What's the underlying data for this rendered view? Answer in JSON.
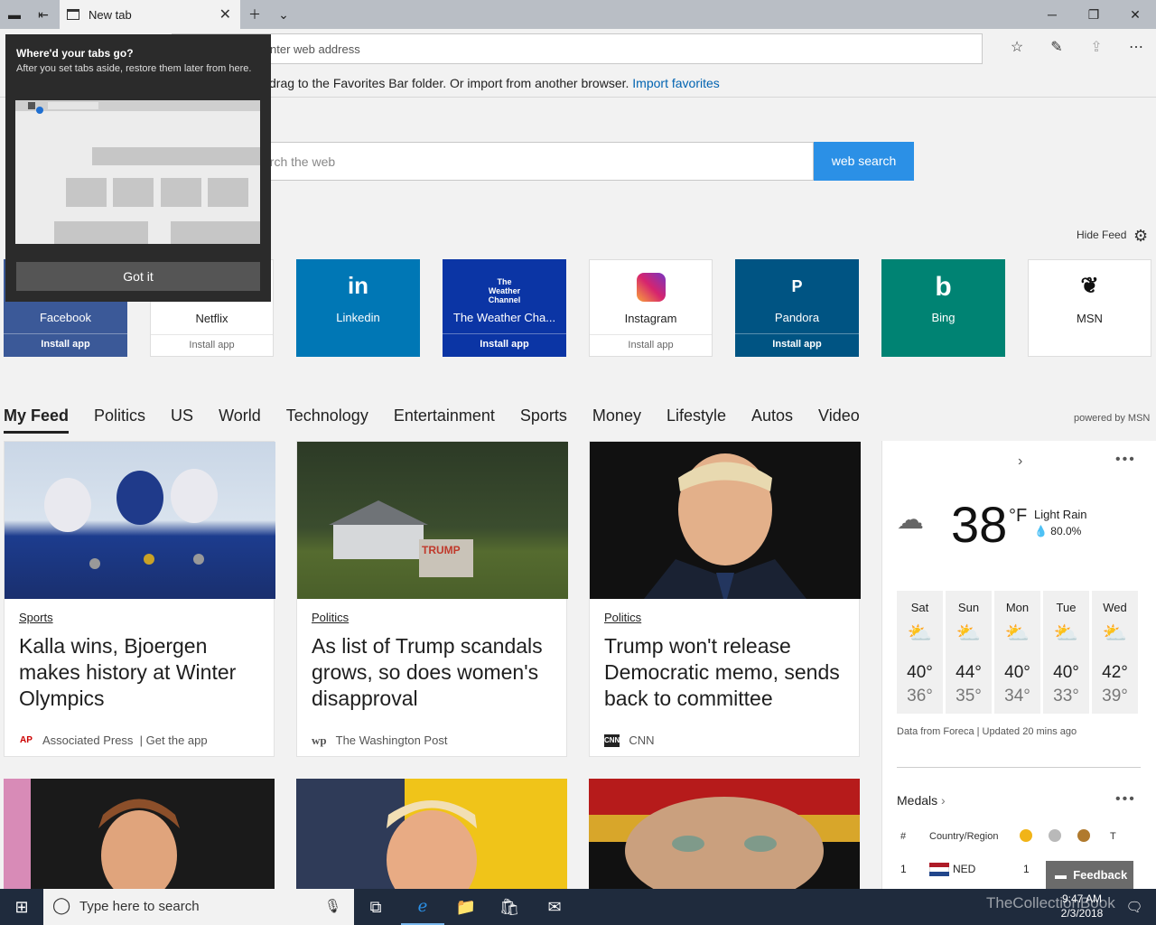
{
  "browser": {
    "tab_title": "New tab",
    "address_placeholder": "Search or enter web address",
    "address_visible": "nter web address",
    "favbar_text": "drag to the Favorites Bar folder. Or import from another browser.",
    "favbar_link": "Import favorites"
  },
  "popup": {
    "title": "Where'd your tabs go?",
    "desc": "After you set tabs aside, restore them later from here.",
    "button": "Got it"
  },
  "search": {
    "placeholder_visible": "arch the web",
    "button": "web search"
  },
  "hide_feed": "Hide Feed",
  "tiles": [
    {
      "name": "Facebook",
      "install": "Install app",
      "bg": "#3b5998",
      "glyph": "f"
    },
    {
      "name": "Netflix",
      "install": "Install app",
      "bg": "#ffffff",
      "glyph": "N"
    },
    {
      "name": "Linkedin",
      "install": "",
      "bg": "#0077b5",
      "glyph": "in"
    },
    {
      "name": "The Weather Cha...",
      "install": "Install app",
      "bg": "#0b35a5",
      "glyph": "TWC"
    },
    {
      "name": "Instagram",
      "install": "Install app",
      "bg": "#ffffff",
      "glyph": "IG"
    },
    {
      "name": "Pandora",
      "install": "Install app",
      "bg": "#005483",
      "glyph": "P"
    },
    {
      "name": "Bing",
      "install": "",
      "bg": "#008373",
      "glyph": "b"
    },
    {
      "name": "MSN",
      "install": "",
      "bg": "#ffffff",
      "glyph": "MSN"
    }
  ],
  "feed_tabs": [
    "My Feed",
    "Politics",
    "US",
    "World",
    "Technology",
    "Entertainment",
    "Sports",
    "Money",
    "Lifestyle",
    "Autos",
    "Video"
  ],
  "powered_by": "powered by MSN",
  "articles": [
    {
      "category": "Sports",
      "headline": "Kalla wins, Bjoergen makes history at Winter Olympics",
      "source": "Associated Press",
      "extra": "| Get the app",
      "logo": "AP"
    },
    {
      "category": "Politics",
      "headline": "As list of Trump scandals grows, so does women's disapproval",
      "source": "The Washington Post",
      "extra": "",
      "logo": "wp"
    },
    {
      "category": "Politics",
      "headline": "Trump won't release Democratic memo, sends back to committee",
      "source": "CNN",
      "extra": "",
      "logo": "CNN"
    }
  ],
  "weather": {
    "temp": "38",
    "unit": "°F",
    "condition": "Light Rain",
    "precip": "80.0%",
    "days": [
      {
        "day": "Sat",
        "hi": "40°",
        "lo": "36°"
      },
      {
        "day": "Sun",
        "hi": "44°",
        "lo": "35°"
      },
      {
        "day": "Mon",
        "hi": "40°",
        "lo": "34°"
      },
      {
        "day": "Tue",
        "hi": "40°",
        "lo": "33°"
      },
      {
        "day": "Wed",
        "hi": "42°",
        "lo": "39°"
      }
    ],
    "source": "Data from Foreca | Updated 20 mins ago"
  },
  "medals": {
    "title": "Medals",
    "hash": "#",
    "country_header": "Country/Region",
    "total_header": "T",
    "row": {
      "rank": "1",
      "country": "NED",
      "gold": "1"
    }
  },
  "feedback": "Feedback",
  "taskbar": {
    "search_placeholder": "Type here to search",
    "time": "9:47 AM",
    "date": "2/3/2018",
    "watermark": "TheCollectionBook"
  }
}
